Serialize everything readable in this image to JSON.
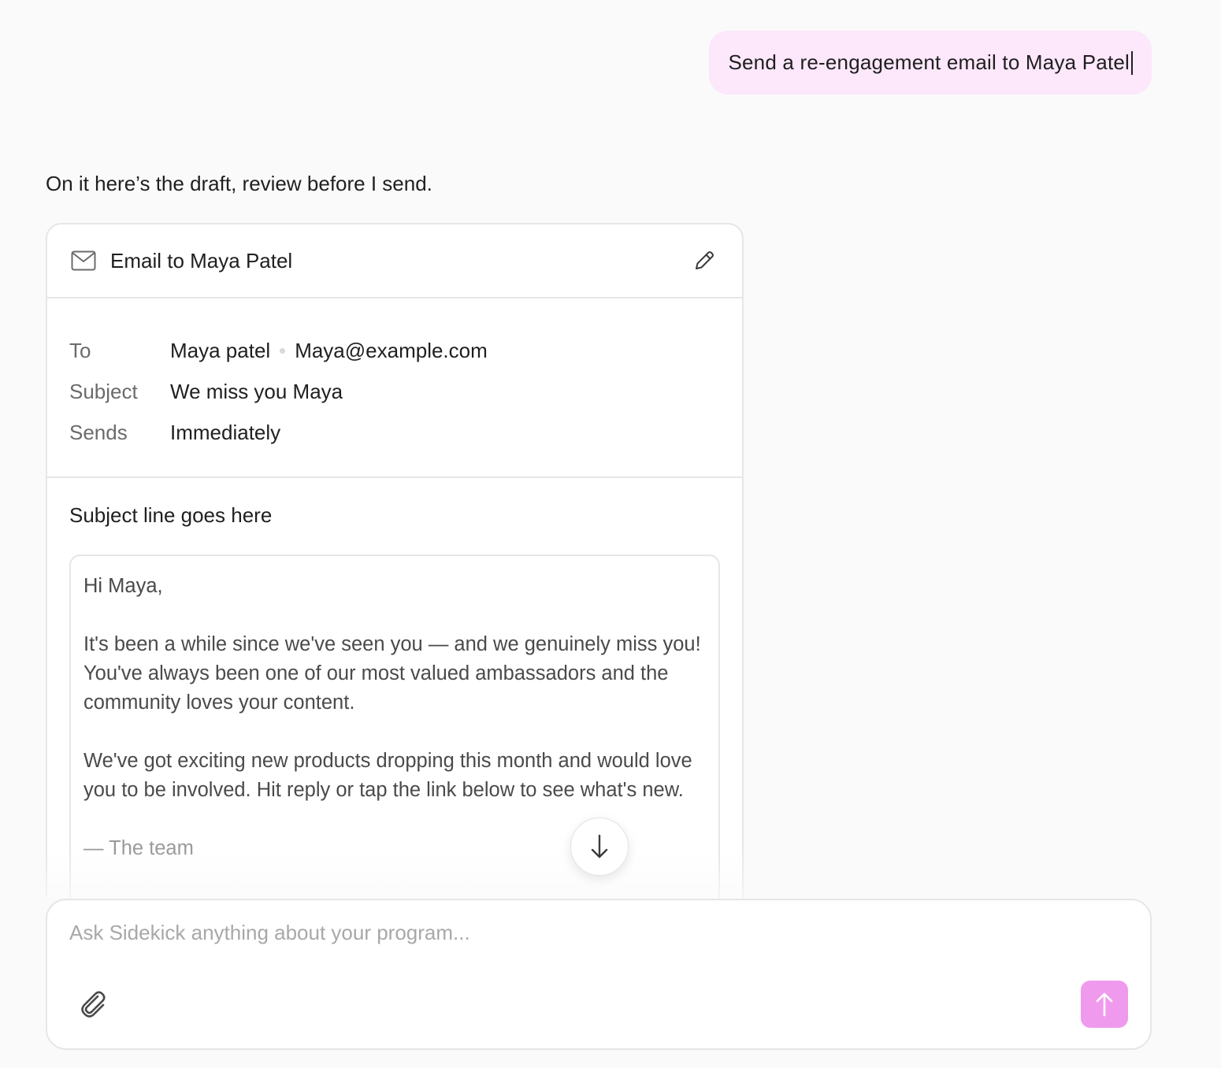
{
  "user_message": {
    "text": "Send a re-engagement email to Maya Patel"
  },
  "assistant": {
    "text": "On it here’s the draft, review before I send."
  },
  "email_card": {
    "title": "Email to Maya Patel",
    "icon": "mail-icon",
    "edit_icon": "pencil-icon",
    "meta": {
      "to_label": "To",
      "to_name": "Maya patel",
      "to_email": "Maya@example.com",
      "subject_label": "Subject",
      "subject_value": "We miss you Maya",
      "sends_label": "Sends",
      "sends_value": "Immediately"
    },
    "preview_subject": "Subject line goes here",
    "body": {
      "greeting": "Hi Maya,",
      "paragraph_1": "It's been a while since we've seen you — and we genuinely miss you! You've always been one of our most valued ambassadors and the community loves your content.",
      "paragraph_2": "We've got exciting new products dropping this month and would love you to be involved. Hit reply or tap the link below to see what's new.",
      "signoff": "— The team"
    }
  },
  "composer": {
    "placeholder": "Ask Sidekick anything about your program...",
    "value": "",
    "attach_icon": "paperclip-icon",
    "send_icon": "arrow-up-icon"
  },
  "colors": {
    "user_bubble": "#fce7fb",
    "send_button": "#f09aee",
    "border": "#e6e6e6",
    "background": "#fafafa"
  }
}
